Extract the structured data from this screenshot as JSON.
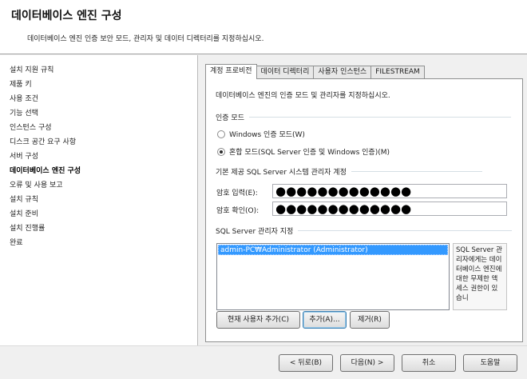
{
  "header": {
    "title": "데이터베이스 엔진 구성",
    "subtitle": "데이터베이스 엔진 인증 보안 모드, 관리자 및 데이터 디렉터리를 지정하십시오."
  },
  "sidebar": {
    "items": [
      {
        "label": "설치 지원 규칙"
      },
      {
        "label": "제품 키"
      },
      {
        "label": "사용 조건"
      },
      {
        "label": "기능 선택"
      },
      {
        "label": "인스턴스 구성"
      },
      {
        "label": "디스크 공간 요구 사항"
      },
      {
        "label": "서버 구성"
      },
      {
        "label": "데이터베이스 엔진 구성"
      },
      {
        "label": "오류 및 사용 보고"
      },
      {
        "label": "설치 규칙"
      },
      {
        "label": "설치 준비"
      },
      {
        "label": "설치 진행률"
      },
      {
        "label": "완료"
      }
    ],
    "active_index": 7
  },
  "tabs": [
    {
      "label": "계정 프로비전"
    },
    {
      "label": "데이터 디렉터리"
    },
    {
      "label": "사용자 인스턴스"
    },
    {
      "label": "FILESTREAM"
    }
  ],
  "panel": {
    "description": "데이터베이스 엔진의 인증 모드 및 관리자를 지정하십시오.",
    "auth_group": "인증 모드",
    "windows_auth": "Windows 인증 모드(W)",
    "mixed_auth": "혼합 모드(SQL Server 인증 및 Windows 인증)(M)",
    "selected_auth": "mixed",
    "sa_group": "기본 제공 SQL Server 시스템 관리자 계정",
    "password_label": "암호 입력(E):",
    "password_value": "●●●●●●●●●●●●●",
    "confirm_label": "암호 확인(O):",
    "confirm_value": "●●●●●●●●●●●●●",
    "admin_group": "SQL Server 관리자 지정",
    "admins": [
      "admin-PC₩Administrator (Administrator)"
    ],
    "hint": "SQL Server 관리자에게는 데이터베이스 엔진에 대한 무제한 액세스 권한이 있습니",
    "add_current_user": "현재 사용자 추가(C)",
    "add": "추가(A)...",
    "remove": "제거(R)"
  },
  "footer": {
    "back": "< 뒤로(B)",
    "next": "다음(N) >",
    "cancel": "취소",
    "help": "도움말"
  }
}
